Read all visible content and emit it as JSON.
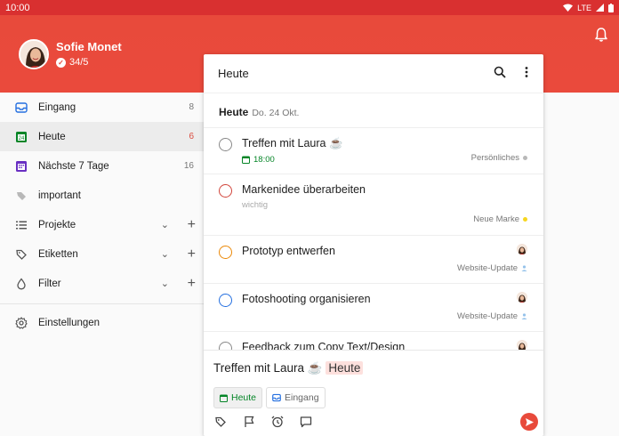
{
  "status_bar": {
    "time": "10:00",
    "network": "LTE"
  },
  "header": {
    "user_name": "Sofie Monet",
    "karma": "34/5"
  },
  "sidebar": {
    "items": [
      {
        "label": "Eingang",
        "count": "8"
      },
      {
        "label": "Heute",
        "count": "6"
      },
      {
        "label": "Nächste 7 Tage",
        "count": "16"
      },
      {
        "label": "important"
      }
    ],
    "sections": [
      {
        "label": "Projekte"
      },
      {
        "label": "Etiketten"
      },
      {
        "label": "Filter"
      }
    ],
    "settings": "Einstellungen"
  },
  "panel": {
    "title": "Heute",
    "day_label": "Heute",
    "day_date": "Do. 24 Okt.",
    "tasks": [
      {
        "title": "Treffen mit Laura ☕",
        "time": "18:00",
        "project": "Persönliches",
        "circle_color": "#888888",
        "dot_color": "#b8b8b8"
      },
      {
        "title": "Markenidee überarbeiten",
        "label": "wichtig",
        "project": "Neue Marke",
        "circle_color": "#d1453b",
        "dot_color": "#f6d61f"
      },
      {
        "title": "Prototyp entwerfen",
        "project": "Website-Update",
        "circle_color": "#eb8909",
        "dot_color": "#96c3eb"
      },
      {
        "title": "Fotoshooting organisieren",
        "project": "Website-Update",
        "circle_color": "#246fe0",
        "dot_color": "#96c3eb"
      },
      {
        "title": "Feedback zum Copy Text/Design",
        "circle_color": "#888888"
      }
    ]
  },
  "quick_add": {
    "text": "Treffen mit Laura ☕",
    "highlight": "Heute",
    "chip_date": "Heute",
    "chip_project": "Eingang"
  },
  "colors": {
    "brand": "#e84a3b",
    "today_green": "#058527"
  }
}
